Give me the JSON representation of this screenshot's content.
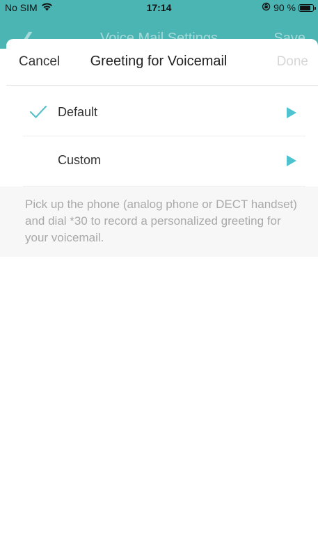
{
  "status_bar": {
    "carrier": "No SIM",
    "time": "17:14",
    "battery_text": "90 %",
    "battery_level": 0.9
  },
  "background_nav": {
    "title": "Voice Mail Settings",
    "right_label": "Save"
  },
  "sheet": {
    "cancel_label": "Cancel",
    "title": "Greeting for Voicemail",
    "done_label": "Done"
  },
  "options": [
    {
      "label": "Default",
      "selected": true
    },
    {
      "label": "Custom",
      "selected": false
    }
  ],
  "info_text": "Pick up the phone (analog phone or DECT handset) and dial *30 to record a personalized greeting for your voicemail.",
  "colors": {
    "accent": "#4ab5b3",
    "check": "#5bbfc9"
  }
}
